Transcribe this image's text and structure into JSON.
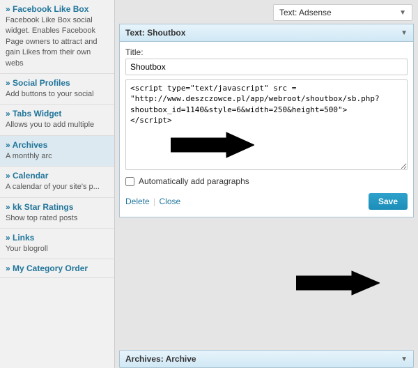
{
  "sidebar": {
    "items": [
      {
        "id": "facebook-like-box",
        "title": "Facebook Like Box",
        "desc": "Facebook Like Box social widget. Enables Facebook Page owners to attract and gain Likes from their own webs"
      },
      {
        "id": "social-profiles",
        "title": "Social Profiles",
        "desc": "Add buttons to your social"
      },
      {
        "id": "tabs-widget",
        "title": "Tabs Widget",
        "desc": "Allows you to add multiple"
      },
      {
        "id": "archives",
        "title": "Archives",
        "desc": "A monthly arc"
      },
      {
        "id": "calendar",
        "title": "Calendar",
        "desc": "A calendar of your site's p..."
      },
      {
        "id": "kk-star-ratings",
        "title": "kk Star Ratings",
        "desc": "Show top rated posts"
      },
      {
        "id": "links",
        "title": "Links",
        "desc": "Your blogroll"
      },
      {
        "id": "my-category-order",
        "title": "My Category Order",
        "desc": ""
      }
    ]
  },
  "top_dropdown": {
    "label": "Text: Adsense"
  },
  "shoutbox": {
    "panel_title": "Text: Shoutbox",
    "title_label": "Title:",
    "title_value": "Shoutbox",
    "script_content": "<script type=\"text/javascript\" src =\n\"http://www.deszczowce.pl/app/webroot/shoutbox/sb.php?shoutbox_id=1140&amp;style=6&amp;width=250&amp;height=500\">\n<\\/script>",
    "checkbox_label": "Automatically add paragraphs",
    "delete_label": "Delete",
    "close_label": "Close",
    "save_label": "Save"
  },
  "bottom_dropdown": {
    "label": "Archives: Archive"
  },
  "arrows": {
    "right_arrow_1": "→",
    "right_arrow_2": "→"
  }
}
